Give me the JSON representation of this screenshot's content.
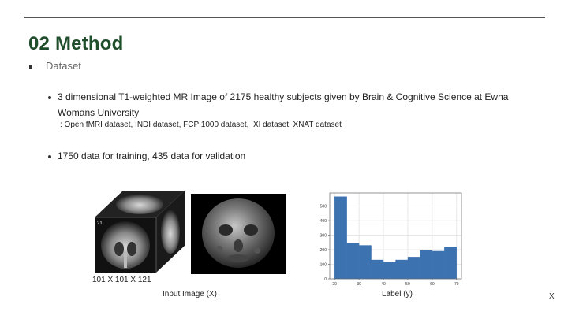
{
  "slide": {
    "title": "02 Method",
    "section": "Dataset",
    "bullets": [
      "3 dimensional T1-weighted MR Image of 2175 healthy subjects given by Brain & Cognitive Science at Ewha Womans University",
      "1750 data for training, 435 data for validation"
    ],
    "bullet1_line1": "3 dimensional T1-weighted MR Image of 2175 healthy subjects given by Brain & Cognitive Science at Ewha",
    "bullet1_line2": "Womans University",
    "sub_note": ": Open fMRI dataset, INDI dataset, FCP 1000 dataset, IXI dataset, XNAT dataset",
    "cube_dims": "101 X 101 X 121",
    "cube_corner_label": "21",
    "input_caption": "Input Image (X)",
    "label_caption": "Label (y)",
    "corner_mark": "X"
  },
  "chart_data": {
    "type": "bar",
    "bin_edges": [
      20,
      25,
      30,
      35,
      40,
      45,
      50,
      55,
      60,
      65,
      70
    ],
    "values": [
      565,
      245,
      230,
      130,
      115,
      130,
      150,
      195,
      190,
      220
    ],
    "xticks": [
      20,
      30,
      40,
      50,
      60,
      70
    ],
    "yticks": [
      0,
      100,
      200,
      300,
      400,
      500
    ],
    "xlim": [
      18,
      72
    ],
    "ylim": [
      0,
      590
    ],
    "grid": true,
    "color": "#3d72b0",
    "title": "",
    "xlabel": "",
    "ylabel": ""
  }
}
